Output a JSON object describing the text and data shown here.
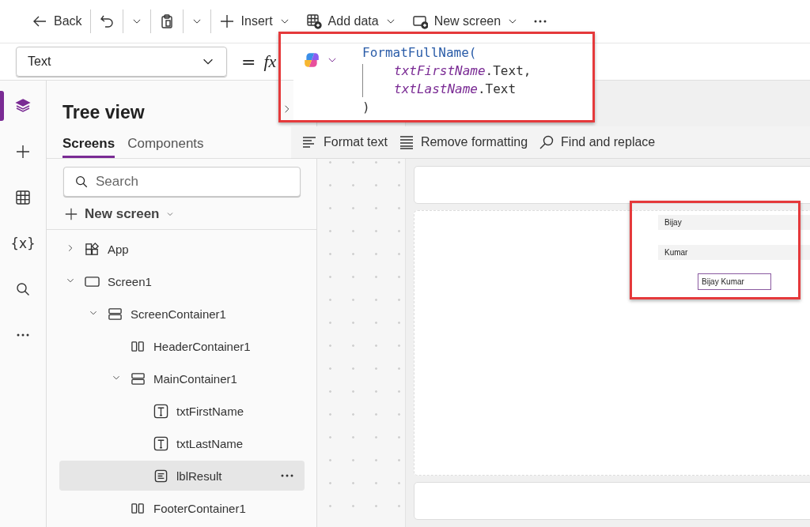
{
  "toolbar": {
    "items": [
      {
        "kind": "back",
        "label": "Back",
        "dropdown": false
      },
      {
        "kind": "undo",
        "dropdown": true
      },
      {
        "kind": "paste",
        "dropdown": true
      },
      {
        "kind": "insert",
        "label": "Insert",
        "dropdown": true
      },
      {
        "kind": "add-data",
        "label": "Add data",
        "dropdown": true
      },
      {
        "kind": "new-screen",
        "label": "New screen",
        "dropdown": true
      },
      {
        "kind": "more"
      }
    ]
  },
  "formula_bar": {
    "property": "Text",
    "equals": "=",
    "fx": "fx",
    "lines": [
      {
        "kind": "open",
        "tokens": [
          {
            "kind": "function",
            "text": "FormatFullName("
          }
        ]
      },
      {
        "kind": "argument",
        "tokens": [
          {
            "kind": "control",
            "text": "txtFirstName"
          },
          {
            "kind": "plain",
            "text": ".Text,"
          }
        ]
      },
      {
        "kind": "argument",
        "tokens": [
          {
            "kind": "control",
            "text": "txtLastName"
          },
          {
            "kind": "plain",
            "text": ".Text"
          }
        ]
      },
      {
        "kind": "close",
        "tokens": [
          {
            "kind": "plain",
            "text": ")"
          }
        ]
      }
    ]
  },
  "format_toolbar": {
    "items": [
      {
        "kind": "format",
        "label": "Format text"
      },
      {
        "kind": "remove",
        "label": "Remove formatting"
      },
      {
        "kind": "find",
        "label": "Find and replace"
      }
    ]
  },
  "left_rail": {
    "items": [
      {
        "kind": "layers",
        "selected": true
      },
      {
        "kind": "insert",
        "selected": false
      },
      {
        "kind": "data",
        "selected": false
      },
      {
        "kind": "variables",
        "label": "{x}",
        "selected": false
      },
      {
        "kind": "search",
        "selected": false
      },
      {
        "kind": "more",
        "selected": false
      }
    ]
  },
  "tree_view": {
    "title": "Tree view",
    "tabs": [
      {
        "label": "Screens",
        "selected": true
      },
      {
        "label": "Components",
        "selected": false
      }
    ],
    "search": {
      "placeholder": "Search"
    },
    "new_screen": "New screen",
    "nodes": [
      {
        "kind": "app",
        "label": "App",
        "expanded": false,
        "selected": false
      },
      {
        "kind": "screen",
        "label": "Screen1",
        "expanded": true,
        "selected": false,
        "children": [
          {
            "kind": "vertical",
            "label": "ScreenContainer1",
            "expanded": true,
            "selected": false,
            "children": [
              {
                "kind": "horizontal",
                "label": "HeaderContainer1",
                "selected": false
              },
              {
                "kind": "vertical",
                "label": "MainContainer1",
                "expanded": true,
                "selected": false,
                "children": [
                  {
                    "kind": "text-input",
                    "label": "txtFirstName",
                    "selected": false
                  },
                  {
                    "kind": "text-input",
                    "label": "txtLastName",
                    "selected": false
                  },
                  {
                    "kind": "label",
                    "label": "lblResult",
                    "selected": true
                  }
                ]
              },
              {
                "kind": "horizontal",
                "label": "FooterContainer1",
                "selected": false
              }
            ]
          }
        ]
      }
    ]
  },
  "canvas": {
    "inputs": [
      {
        "value": "Bijay"
      },
      {
        "value": "Kumar"
      }
    ],
    "result": "Bijay Kumar"
  }
}
